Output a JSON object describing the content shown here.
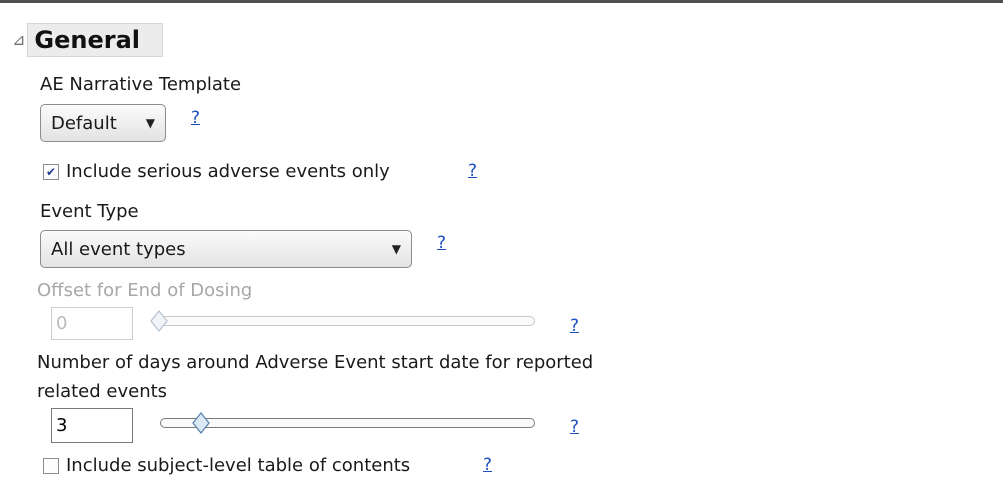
{
  "section": {
    "title": "General"
  },
  "template": {
    "label": "AE Narrative Template",
    "selected": "Default",
    "help": "?"
  },
  "serious": {
    "label": "Include serious adverse events only",
    "checked": true,
    "help": "?"
  },
  "event_type": {
    "label": "Event Type",
    "selected": "All event types",
    "help": "?"
  },
  "offset": {
    "label": "Offset for End of Dosing",
    "value": "0",
    "slider_fraction": 0.0,
    "enabled": false,
    "help": "?"
  },
  "days_around": {
    "label_line1": "Number of days around Adverse Event start date for reported",
    "label_line2": "related events",
    "value": "3",
    "slider_fraction": 0.1,
    "help": "?"
  },
  "toc": {
    "label": "Include subject-level table of contents",
    "checked": false,
    "help": "?"
  },
  "icons": {
    "section_toggle": "disclosure-triangle-icon",
    "dropdown": "chevron-down-icon",
    "slider_thumb": "diamond-thumb-icon",
    "checkmark": "checkmark-icon"
  },
  "colors": {
    "link": "#1a4fc0",
    "disabled_text": "#a8a8a8",
    "thumb_fill": "#dbe9f7",
    "thumb_stroke": "#5a7fa8"
  }
}
